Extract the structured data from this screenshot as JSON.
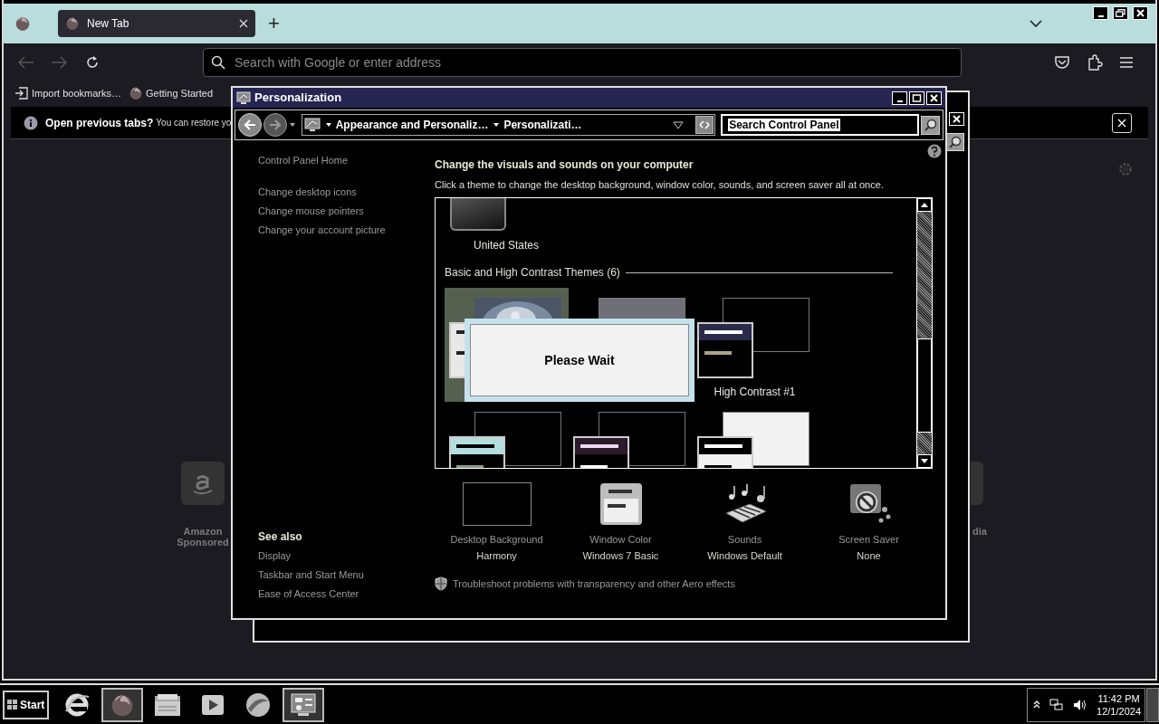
{
  "browser": {
    "tabs": [
      {
        "label": "New Tab",
        "selected": true
      }
    ],
    "new_tab_button": "+",
    "address_placeholder": "Search with Google or enter address",
    "bookmarks": [
      {
        "kind": "import",
        "label": "Import bookmarks…"
      },
      {
        "kind": "firefox",
        "label": "Getting Started"
      }
    ],
    "notification": {
      "title": "Open previous tabs?",
      "text": "You can restore yo"
    },
    "shortcuts": [
      {
        "kind": "amazon",
        "label": "Amazon",
        "sublabel": "Sponsored"
      },
      {
        "kind": "cut",
        "label": "dia"
      }
    ]
  },
  "personalization": {
    "title": "Personalization",
    "breadcrumbs": [
      "Appearance and Personaliz…",
      "Personalizati…"
    ],
    "search_value": "Search Control Panel",
    "sidebar_links": [
      "Control Panel Home",
      "Change desktop icons",
      "Change mouse pointers",
      "Change your account picture"
    ],
    "see_also": {
      "title": "See also",
      "links": [
        "Display",
        "Taskbar and Start Menu",
        "Ease of Access Center"
      ]
    },
    "heading": "Change the visuals and sounds on your computer",
    "description": "Click a theme to change the desktop background, window color, sounds, and screen saver all at once.",
    "top_theme_label": "United States",
    "section_title": "Basic and High Contrast Themes (6)",
    "themes": [
      {
        "kind": "basic",
        "selected": true
      },
      {
        "kind": "classic",
        "selected": false
      },
      {
        "kind": "high-contrast-1",
        "selected": false,
        "label": "High Contrast #1"
      },
      {
        "kind": "high-contrast-2",
        "selected": false
      },
      {
        "kind": "high-contrast-black",
        "selected": false
      },
      {
        "kind": "high-contrast-white",
        "selected": false
      }
    ],
    "settings": [
      {
        "kind": "background",
        "title": "Desktop Background",
        "value": "Harmony"
      },
      {
        "kind": "window-color",
        "title": "Window Color",
        "value": "Windows 7 Basic"
      },
      {
        "kind": "sounds",
        "title": "Sounds",
        "value": "Windows Default"
      },
      {
        "kind": "screen-saver",
        "title": "Screen Saver",
        "value": "None"
      }
    ],
    "troubleshoot": "Troubleshoot problems with transparency and other Aero effects"
  },
  "dialog": {
    "message": "Please Wait"
  },
  "taskbar": {
    "start": "Start",
    "apps": [
      {
        "kind": "ie",
        "active": false
      },
      {
        "kind": "firefox",
        "active": true
      },
      {
        "kind": "explorer",
        "active": false
      },
      {
        "kind": "media",
        "active": false
      },
      {
        "kind": "globe",
        "active": false
      },
      {
        "kind": "control-panel",
        "active": true
      }
    ],
    "time": "11:42 PM",
    "date": "12/1/2024"
  }
}
